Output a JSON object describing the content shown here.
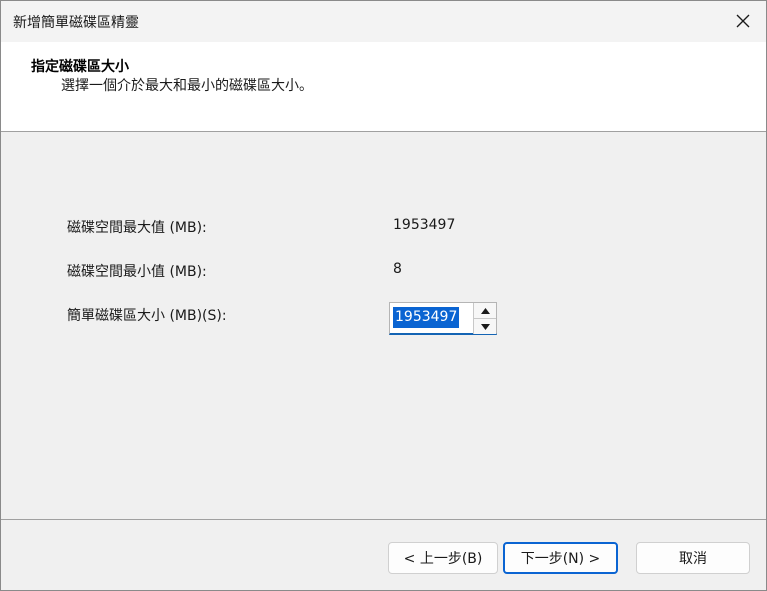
{
  "window": {
    "title": "新增簡單磁碟區精靈",
    "close_icon": "close-icon"
  },
  "header": {
    "title": "指定磁碟區大小",
    "subtitle": "選擇一個介於最大和最小的磁碟區大小。"
  },
  "form": {
    "max_label": "磁碟空間最大值 (MB):",
    "max_value": "1953497",
    "min_label": "磁碟空間最小值 (MB):",
    "min_value": "8",
    "size_label": "簡單磁碟區大小 (MB)(S):",
    "size_value": "1953497"
  },
  "buttons": {
    "back": "< 上一步(B)",
    "next": "下一步(N) >",
    "cancel": "取消"
  },
  "colors": {
    "accent": "#0a64d2",
    "selection_text": "#ffffff"
  }
}
